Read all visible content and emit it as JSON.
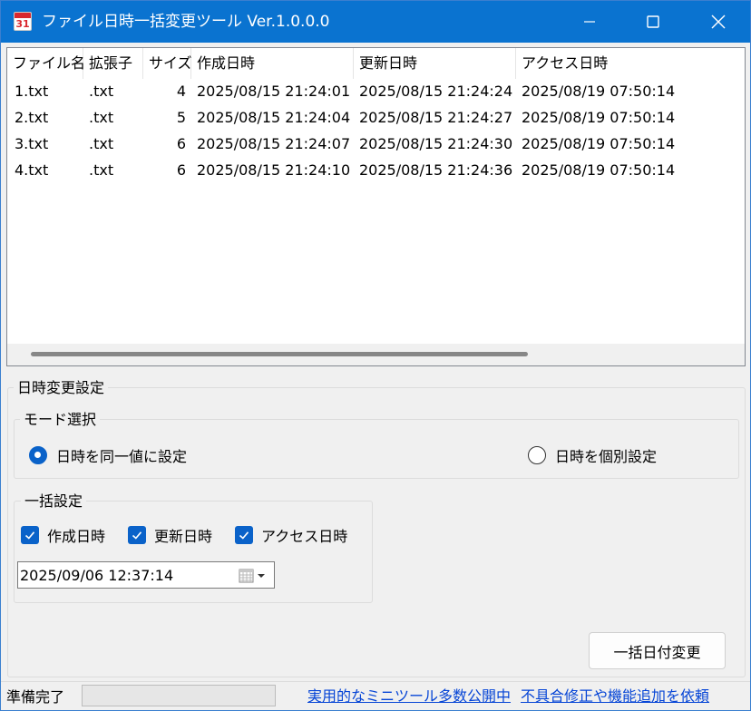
{
  "window": {
    "title": "ファイル日時一括変更ツール Ver.1.0.0.0",
    "icon_text": "31",
    "icon": "calendar-icon",
    "accent_color": "#0a73d0"
  },
  "file_list": {
    "columns": {
      "name": "ファイル名",
      "ext": "拡張子",
      "size": "サイズ",
      "created": "作成日時",
      "modified": "更新日時",
      "accessed": "アクセス日時"
    },
    "rows": [
      {
        "name": "1.txt",
        "ext": ".txt",
        "size": "4",
        "created": "2025/08/15 21:24:01",
        "modified": "2025/08/15 21:24:24",
        "accessed": "2025/08/19 07:50:14"
      },
      {
        "name": "2.txt",
        "ext": ".txt",
        "size": "5",
        "created": "2025/08/15 21:24:04",
        "modified": "2025/08/15 21:24:27",
        "accessed": "2025/08/19 07:50:14"
      },
      {
        "name": "3.txt",
        "ext": ".txt",
        "size": "6",
        "created": "2025/08/15 21:24:07",
        "modified": "2025/08/15 21:24:30",
        "accessed": "2025/08/19 07:50:14"
      },
      {
        "name": "4.txt",
        "ext": ".txt",
        "size": "6",
        "created": "2025/08/15 21:24:10",
        "modified": "2025/08/15 21:24:36",
        "accessed": "2025/08/19 07:50:14"
      }
    ]
  },
  "settings": {
    "group_title": "日時変更設定",
    "mode": {
      "title": "モード選択",
      "option_same": "日時を同一値に設定",
      "option_individual": "日時を個別設定",
      "selected": "same"
    },
    "bulk": {
      "title": "一括設定",
      "created_label": "作成日時",
      "modified_label": "更新日時",
      "accessed_label": "アクセス日時",
      "created_checked": true,
      "modified_checked": true,
      "accessed_checked": true,
      "datetime_value": "2025/09/06 12:37:14"
    },
    "apply_button": "一括日付変更"
  },
  "status": {
    "text": "準備完了",
    "link_tools": "実用的なミニツール多数公開中",
    "link_report": "不具合修正や機能追加を依頼",
    "link_color": "#0645d6"
  }
}
